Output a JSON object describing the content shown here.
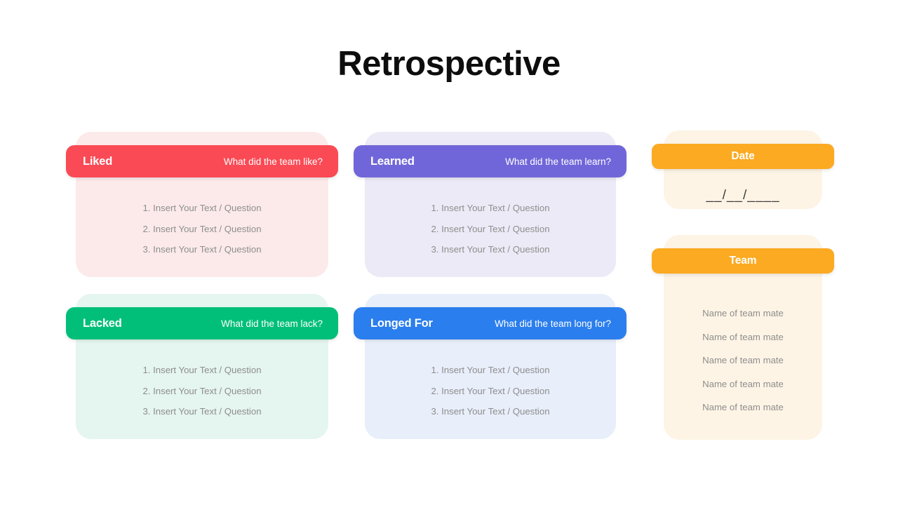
{
  "title": "Retrospective",
  "colors": {
    "liked": "#fa4a55",
    "learned": "#7166d9",
    "lacked": "#01bf78",
    "longed_for": "#2b7eed",
    "accent_orange": "#fbaa21",
    "title_text": "#0d0d0d",
    "placeholder_text": "#8e8e8e"
  },
  "cards": [
    {
      "id": "liked",
      "title": "Liked",
      "question": "What did the team like?",
      "lines": [
        "1. Insert Your Text / Question",
        "2. Insert Your Text / Question",
        "3. Insert Your Text / Question"
      ]
    },
    {
      "id": "learned",
      "title": "Learned",
      "question": "What did the team learn?",
      "lines": [
        "1. Insert Your Text / Question",
        "2. Insert Your Text / Question",
        "3. Insert Your Text / Question"
      ]
    },
    {
      "id": "lacked",
      "title": "Lacked",
      "question": "What did the team lack?",
      "lines": [
        "1. Insert Your Text / Question",
        "2. Insert Your Text / Question",
        "3. Insert Your Text / Question"
      ]
    },
    {
      "id": "longed_for",
      "title": "Longed For",
      "question": "What did the team long for?",
      "lines": [
        "1. Insert Your Text / Question",
        "2. Insert Your Text / Question",
        "3. Insert Your Text / Question"
      ]
    }
  ],
  "date_panel": {
    "title": "Date",
    "value": "__/__/____"
  },
  "team_panel": {
    "title": "Team",
    "members": [
      "Name of team mate",
      "Name of team mate",
      "Name of team mate",
      "Name of team mate",
      "Name of team mate"
    ]
  }
}
